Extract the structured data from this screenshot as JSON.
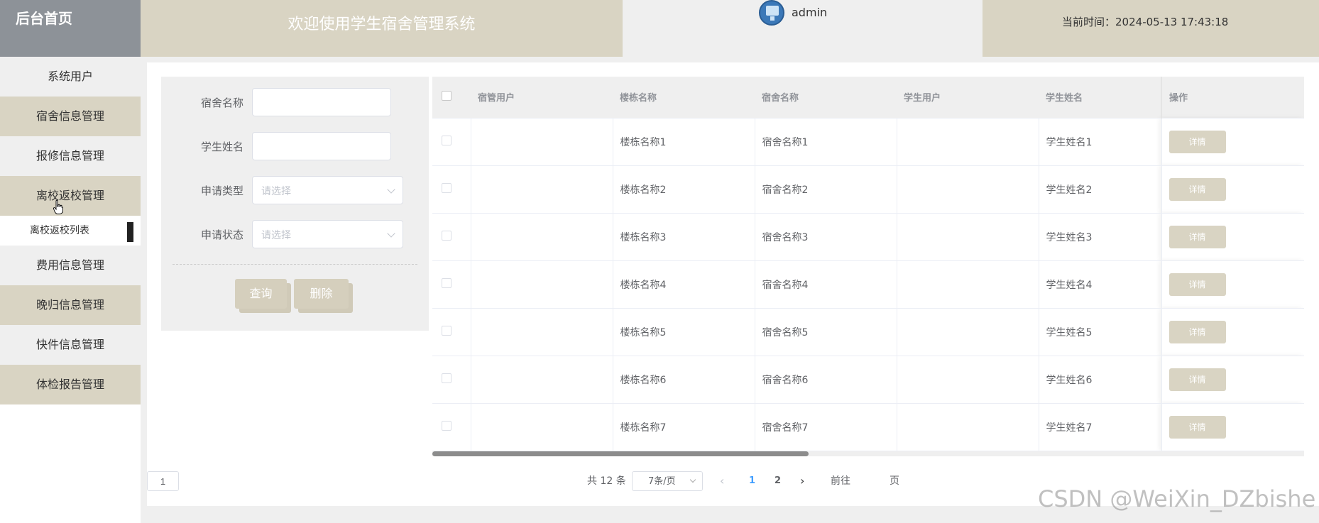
{
  "header": {
    "brand": "后台首页",
    "welcome": "欢迎使用学生宿舍管理系统",
    "username": "admin",
    "time_label": "当前时间：",
    "time_value": "2024-05-13 17:43:18"
  },
  "sidebar": {
    "items": [
      {
        "label": "系统用户"
      },
      {
        "label": "宿舍信息管理"
      },
      {
        "label": "报修信息管理"
      },
      {
        "label": "离校返校管理"
      },
      {
        "label": "费用信息管理"
      },
      {
        "label": "晚归信息管理"
      },
      {
        "label": "快件信息管理"
      },
      {
        "label": "体检报告管理"
      }
    ],
    "submenu": {
      "label": "离校返校列表"
    }
  },
  "search": {
    "dorm_name_label": "宿舍名称",
    "student_name_label": "学生姓名",
    "apply_type_label": "申请类型",
    "apply_type_placeholder": "请选择",
    "apply_status_label": "申请状态",
    "apply_status_placeholder": "请选择",
    "query_button": "查询",
    "delete_button": "删除"
  },
  "table": {
    "headers": {
      "manager_user": "宿管用户",
      "building_name": "楼栋名称",
      "dorm_name": "宿舍名称",
      "student_user": "学生用户",
      "student_name": "学生姓名",
      "operation": "操作"
    },
    "detail_label": "详情",
    "rows": [
      {
        "manager_user": "",
        "building_name": "楼栋名称1",
        "dorm_name": "宿舍名称1",
        "student_user": "",
        "student_name": "学生姓名1"
      },
      {
        "manager_user": "",
        "building_name": "楼栋名称2",
        "dorm_name": "宿舍名称2",
        "student_user": "",
        "student_name": "学生姓名2"
      },
      {
        "manager_user": "",
        "building_name": "楼栋名称3",
        "dorm_name": "宿舍名称3",
        "student_user": "",
        "student_name": "学生姓名3"
      },
      {
        "manager_user": "",
        "building_name": "楼栋名称4",
        "dorm_name": "宿舍名称4",
        "student_user": "",
        "student_name": "学生姓名4"
      },
      {
        "manager_user": "",
        "building_name": "楼栋名称5",
        "dorm_name": "宿舍名称5",
        "student_user": "",
        "student_name": "学生姓名5"
      },
      {
        "manager_user": "",
        "building_name": "楼栋名称6",
        "dorm_name": "宿舍名称6",
        "student_user": "",
        "student_name": "学生姓名6"
      },
      {
        "manager_user": "",
        "building_name": "楼栋名称7",
        "dorm_name": "宿舍名称7",
        "student_user": "",
        "student_name": "学生姓名7"
      }
    ]
  },
  "pagination": {
    "total_text": "共 12 条",
    "page_size": "7条/页",
    "pages": [
      "1",
      "2"
    ],
    "current_page": "1",
    "goto_label": "前往",
    "goto_value": "1",
    "page_suffix": "页"
  },
  "watermark": "CSDN @WeiXin_DZbishe",
  "colors": {
    "brand_bg": "#8d9298",
    "accent_beige": "#d9d4c3",
    "page_bg": "#efefef",
    "link_blue": "#409eff"
  }
}
